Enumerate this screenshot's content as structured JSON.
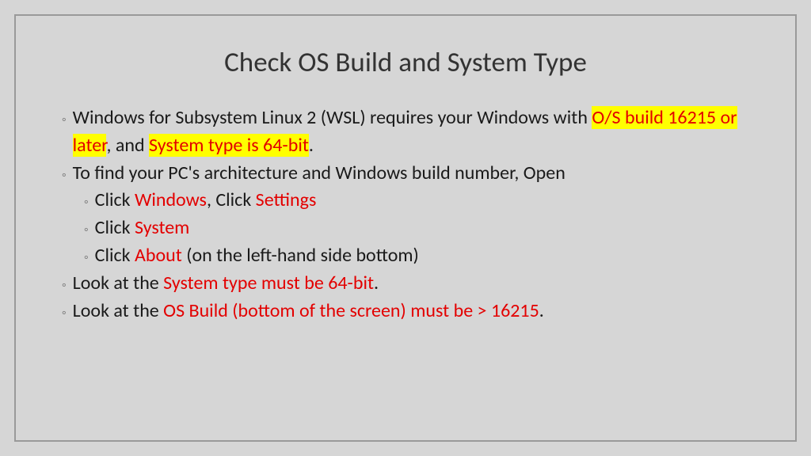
{
  "title": "Check OS Build and System Type",
  "b1": {
    "t1": "Windows for Subsystem Linux 2 (WSL) requires your Windows with ",
    "hl1": "O/S build 16215 or later",
    "t2": ", and ",
    "hl2": "System type is 64-bit",
    "t3": "."
  },
  "b2": {
    "t1": "To find your PC's architecture and Windows build number, Open"
  },
  "b2a": {
    "t1": "Click ",
    "r1": "Windows",
    "t2": ", Click ",
    "r2": "Settings"
  },
  "b2b": {
    "t1": "Click ",
    "r1": "System"
  },
  "b2c": {
    "t1": "Click ",
    "r1": "About",
    "t2": " (on the left-hand side bottom)"
  },
  "b3": {
    "t1": "Look at the ",
    "r1": "System type must be 64-bit",
    "t2": "."
  },
  "b4": {
    "t1": "Look at the ",
    "r1": "OS Build (bottom of the screen) must be > 16215",
    "t2": "."
  }
}
